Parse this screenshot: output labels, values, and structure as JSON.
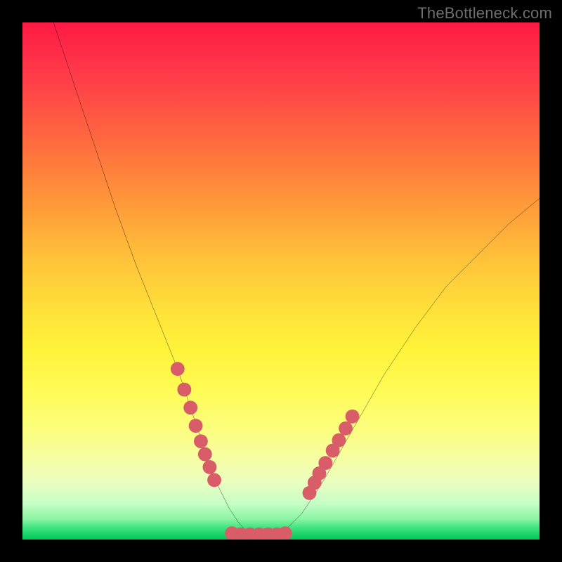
{
  "watermark": {
    "text": "TheBottleneck.com"
  },
  "colors": {
    "background": "#000000",
    "curve": "#000000",
    "marker": "#d95d68",
    "gradient_top": "#ff1a44",
    "gradient_bottom": "#00c85a"
  },
  "chart_data": {
    "type": "line",
    "title": "",
    "xlabel": "",
    "ylabel": "",
    "xlim": [
      0,
      100
    ],
    "ylim": [
      0,
      100
    ],
    "grid": false,
    "series": [
      {
        "name": "bottleneck-curve",
        "x": [
          6,
          10,
          14,
          18,
          22,
          26,
          30,
          34,
          36,
          38,
          40,
          42,
          44,
          46,
          48,
          50,
          54,
          58,
          62,
          66,
          70,
          76,
          82,
          88,
          94,
          100
        ],
        "y": [
          100,
          88,
          76,
          64,
          53,
          43,
          33,
          21,
          15,
          10,
          6,
          3,
          1,
          1,
          1,
          1,
          5,
          11,
          18,
          25,
          32,
          41,
          49,
          55,
          61,
          66
        ]
      }
    ],
    "markers": [
      {
        "name": "left-cluster",
        "x": [
          30,
          31.3,
          32.5,
          33.5,
          34.5,
          35.3,
          36.2,
          37.1
        ],
        "y": [
          33,
          29,
          25.5,
          22,
          19,
          16.5,
          14,
          11.5
        ]
      },
      {
        "name": "valley-floor",
        "x": [
          40.5,
          42.3,
          44,
          45.8,
          47.5,
          49.2,
          50.8
        ],
        "y": [
          1.2,
          1.0,
          1.0,
          1.0,
          1.0,
          1.0,
          1.2
        ]
      },
      {
        "name": "right-cluster",
        "x": [
          55.5,
          56.5,
          57.4,
          58.6,
          60,
          61.2,
          62.5,
          63.8
        ],
        "y": [
          9,
          11,
          12.8,
          14.8,
          17.2,
          19.2,
          21.5,
          23.8
        ]
      }
    ]
  }
}
